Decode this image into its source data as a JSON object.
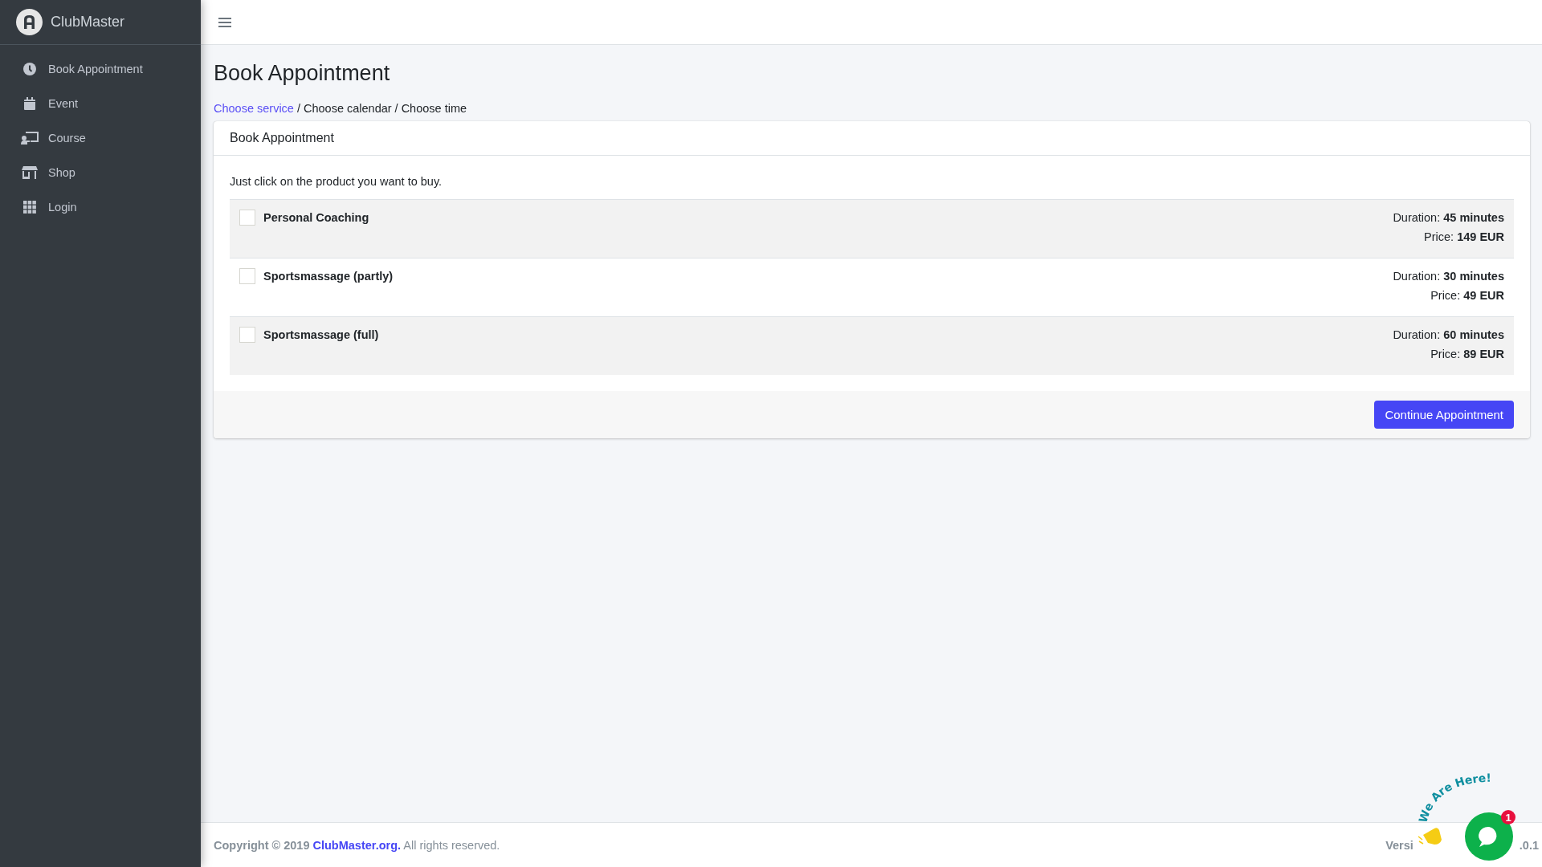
{
  "brand": {
    "name": "ClubMaster"
  },
  "sidebar": {
    "items": [
      {
        "label": "Book Appointment"
      },
      {
        "label": "Event"
      },
      {
        "label": "Course"
      },
      {
        "label": "Shop"
      },
      {
        "label": "Login"
      }
    ]
  },
  "page_title": "Book Appointment",
  "breadcrumb": [
    {
      "label": "Choose service",
      "kind": "link"
    },
    {
      "label": "/",
      "kind": "separator"
    },
    {
      "label": "Choose calendar",
      "kind": "text"
    },
    {
      "label": "/",
      "kind": "separator"
    },
    {
      "label": "Choose time",
      "kind": "text"
    }
  ],
  "card": {
    "title": "Book Appointment",
    "intro": "Just click on the product you want to buy.",
    "products": [
      {
        "name": "Personal Coaching",
        "checked": false,
        "duration": "Duration: **45 minutes**",
        "price": "Price: **149 EUR**"
      },
      {
        "name": "Sportsmassage (partly)",
        "checked": false,
        "duration": "Duration: **30 minutes**",
        "price": "Price: **49 EUR**"
      },
      {
        "name": "Sportsmassage (full)",
        "checked": false,
        "duration": "Duration: **60 minutes**",
        "price": "Price: **89 EUR**"
      }
    ],
    "button": "Continue Appointment"
  },
  "footer": {
    "copyright": "Copyright © 2019",
    "link": "ClubMaster.org.",
    "rights": "All rights reserved.",
    "version_parts": [
      "Versi",
      ".0.1"
    ]
  },
  "chat_widget": {
    "greeting": "We Are Here!",
    "badge": "1"
  }
}
